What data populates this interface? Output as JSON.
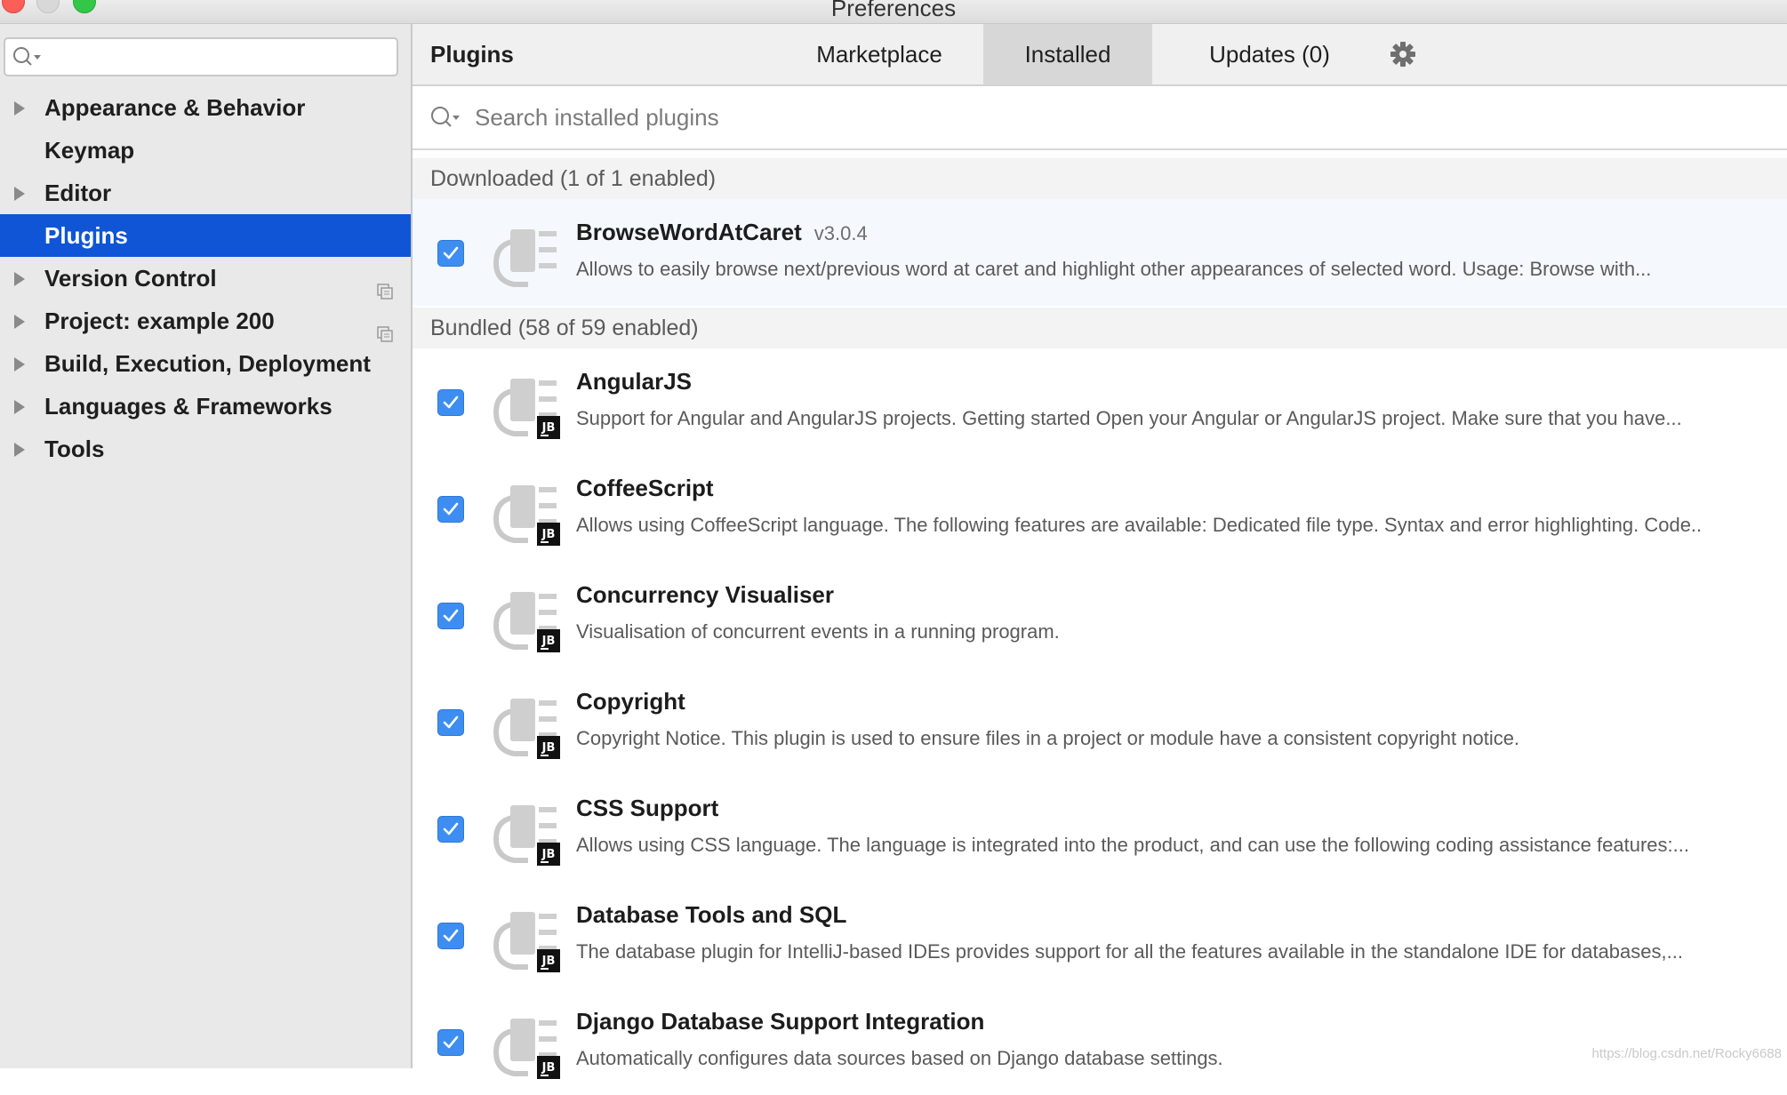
{
  "window": {
    "title": "Preferences"
  },
  "sidebar": {
    "search_placeholder": "",
    "items": [
      {
        "label": "Appearance & Behavior",
        "expandable": true,
        "selected": false,
        "project_icon": false
      },
      {
        "label": "Keymap",
        "expandable": false,
        "selected": false,
        "project_icon": false
      },
      {
        "label": "Editor",
        "expandable": true,
        "selected": false,
        "project_icon": false
      },
      {
        "label": "Plugins",
        "expandable": false,
        "selected": true,
        "project_icon": false
      },
      {
        "label": "Version Control",
        "expandable": true,
        "selected": false,
        "project_icon": true
      },
      {
        "label": "Project: example 200",
        "expandable": true,
        "selected": false,
        "project_icon": true
      },
      {
        "label": "Build, Execution, Deployment",
        "expandable": true,
        "selected": false,
        "project_icon": false
      },
      {
        "label": "Languages & Frameworks",
        "expandable": true,
        "selected": false,
        "project_icon": false
      },
      {
        "label": "Tools",
        "expandable": true,
        "selected": false,
        "project_icon": false
      }
    ]
  },
  "header": {
    "title": "Plugins",
    "tabs": {
      "marketplace": "Marketplace",
      "installed": "Installed",
      "updates": "Updates (0)"
    },
    "active_tab": "Installed"
  },
  "search": {
    "placeholder": "Search installed plugins"
  },
  "sections": {
    "downloaded": "Downloaded (1 of 1 enabled)",
    "bundled": "Bundled (58 of 59 enabled)"
  },
  "plugins": [
    {
      "name": "BrowseWordAtCaret",
      "version": "v3.0.4",
      "jb": false,
      "checked": true,
      "description": "Allows to easily browse next/previous word at caret and highlight other appearances of selected word. Usage: Browse with..."
    },
    {
      "name": "AngularJS",
      "version": "",
      "jb": true,
      "checked": true,
      "description": "Support for Angular and AngularJS projects. Getting started Open your Angular or AngularJS project. Make sure that you have..."
    },
    {
      "name": "CoffeeScript",
      "version": "",
      "jb": true,
      "checked": true,
      "description": "Allows using CoffeeScript language. The following features are available: Dedicated file type. Syntax and error highlighting. Code.."
    },
    {
      "name": "Concurrency Visualiser",
      "version": "",
      "jb": true,
      "checked": true,
      "description": "Visualisation of concurrent events in a running program."
    },
    {
      "name": "Copyright",
      "version": "",
      "jb": true,
      "checked": true,
      "description": "Copyright Notice. This plugin is used to ensure files in a project or module have a consistent copyright notice."
    },
    {
      "name": "CSS Support",
      "version": "",
      "jb": true,
      "checked": true,
      "description": "Allows using CSS language. The language is integrated into the product, and can use the following coding assistance features:..."
    },
    {
      "name": "Database Tools and SQL",
      "version": "",
      "jb": true,
      "checked": true,
      "description": "The database plugin for IntelliJ-based IDEs provides support for all the features available in the standalone IDE for databases,..."
    },
    {
      "name": "Django Database Support Integration",
      "version": "",
      "jb": true,
      "checked": true,
      "description": "Automatically configures data sources based on Django database settings."
    }
  ],
  "icons": {
    "plugin": "plugin-icon",
    "jb_badge": "JB",
    "settings": "gear-icon",
    "search": "search-icon"
  },
  "colors": {
    "selection": "#0f55d6",
    "checkbox": "#3d8ef0",
    "highlight_row": "#f5f8fd"
  },
  "watermark": "https://blog.csdn.net/Rocky6688"
}
